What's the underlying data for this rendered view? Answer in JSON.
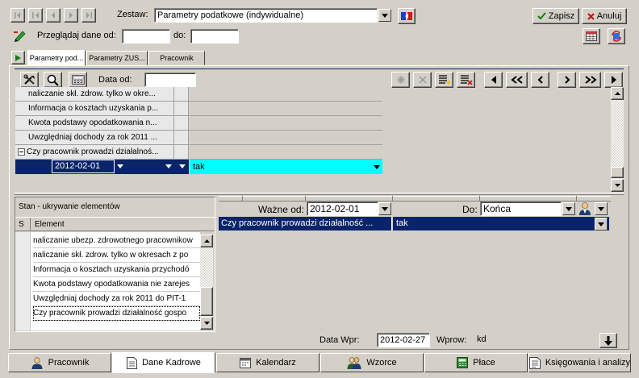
{
  "header": {
    "zestaw_label": "Zestaw:",
    "zestaw_value": "Parametry podatkowe (indywidualne)",
    "zapisz_label": "Zapisz",
    "anuluj_label": "Anuluj",
    "przegladaj_label": "Przeglądaj dane od:",
    "do_label": "do:",
    "od_value": "",
    "do_value": ""
  },
  "tabs": [
    {
      "label": "Parametry pod..."
    },
    {
      "label": "Parametry ZUS..."
    },
    {
      "label": "Pracownik"
    }
  ],
  "toolbar": {
    "data_od_label": "Data od:",
    "data_od_value": ""
  },
  "grid": {
    "rows": [
      {
        "label": "naliczanie skł. zdrow. tylko w okre..."
      },
      {
        "label": "Informacja o kosztach uzyskania p..."
      },
      {
        "label": "Kwota podstawy opodatkowania n..."
      },
      {
        "label": "Uwzględniaj dochody za rok 2011 ..."
      },
      {
        "label": "Czy pracownik prowadzi działalnoś..."
      }
    ],
    "selected_date": "2012-02-01",
    "selected_value": "tak"
  },
  "stan": {
    "title": "Stan - ukrywanie elementów",
    "col_s": "S",
    "col_element": "Element",
    "items": [
      {
        "label": "naliczanie ubezp. zdrowotnego pracownikow"
      },
      {
        "label": "naliczanie skł. zdrow. tylko w okresach z po"
      },
      {
        "label": "Informacja o kosztach uzyskania przychodó"
      },
      {
        "label": "Kwota podstawy opodatkowania nie zarejes"
      },
      {
        "label": "Uwzględniaj dochody za rok 2011 do PIT-1"
      },
      {
        "label": "Czy pracownik prowadzi działalność gospo"
      }
    ]
  },
  "right": {
    "wazne_od_label": "Ważne od:",
    "wazne_od_value": "2012-02-01",
    "do_label": "Do:",
    "do_value": "Końca",
    "row_label": "Czy pracownik prowadzi działalność ...",
    "row_value": "tak"
  },
  "footer": {
    "data_wpr_label": "Data Wpr:",
    "data_wpr_value": "2012-02-27",
    "wprow_label": "Wprow:",
    "wprow_value": "kd"
  },
  "bottom_tabs": [
    {
      "label": "Pracownik"
    },
    {
      "label": "Dane Kadrowe"
    },
    {
      "label": "Kalendarz"
    },
    {
      "label": "Wzorce"
    },
    {
      "label": "Płace"
    },
    {
      "label": "Księgowania i analizy"
    }
  ],
  "colors": {
    "selection_navy": "#0a246a",
    "cyan_highlight": "#00ffff",
    "window_gray": "#d4d0c8"
  }
}
